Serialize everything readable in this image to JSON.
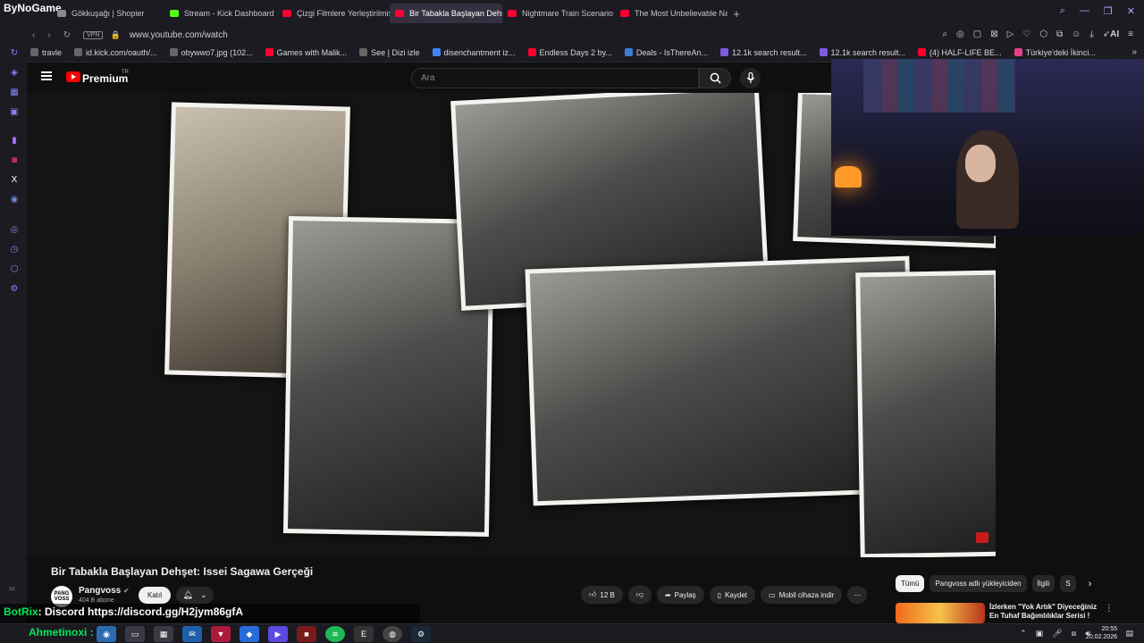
{
  "browser": {
    "brand": "ByNoGame",
    "tabs": [
      {
        "label": "Gökkuşağı | Shopier",
        "color": "#8a8a8a"
      },
      {
        "label": "Stream - Kick Dashboard",
        "color": "#53fc18"
      },
      {
        "label": "Çizgi Filmlere Yerleştirilmiş",
        "color": "#ff0033"
      },
      {
        "label": "Bir Tabakla Başlayan Dehşet",
        "color": "#ff0033"
      },
      {
        "label": "Nightmare Train Scenario",
        "color": "#ff0033"
      },
      {
        "label": "The Most Unbelievable Na",
        "color": "#ff0033"
      }
    ],
    "new_tab": "+",
    "address": {
      "vpn": "VPN",
      "url": "www.youtube.com/watch",
      "ai_label": "AI"
    },
    "bookmarks": [
      "travle",
      "id.kick.com/oauth/...",
      "obywwo7.jpg (102...",
      "Games with Malik...",
      "See | Dizi izle",
      "disenchantment iz...",
      "Endless Days 2 by...",
      "Deals - IsThereAn...",
      "12.1k search result...",
      "12.1k search result...",
      "(4) HALF-LIFE BE...",
      "Türkiye'deki İkinci..."
    ]
  },
  "youtube": {
    "logo_text": "Premium",
    "region": "TR",
    "search_placeholder": "Ara",
    "video": {
      "title": "Bir Tabakla Başlayan Dehşet: Issei Sagawa Gerçeği"
    },
    "channel": {
      "avatar_text": "PANG VOSS",
      "name": "Pangvoss",
      "subscribers": "404 B abone",
      "join": "Katıl"
    },
    "actions": {
      "likes": "12 B",
      "share": "Paylaş",
      "save": "Kaydet",
      "download": "Mobil cihaza indir"
    },
    "chips": [
      "Tümü",
      "Pangvoss adlı yükleyiciden",
      "İlgili",
      "S"
    ],
    "recommendation": {
      "title": "İzlerken \"Yok Artık\" Diyeceğiniz En Tuhaf Bağımlılıklar Serisi !"
    }
  },
  "overlay": {
    "sx": "sx",
    "chat_user": "BotRix",
    "chat_message": ": Discord https://discord.gg/H2jym86gfA"
  },
  "taskbar": {
    "user": "Ahmetinoxi :",
    "time": "20:55",
    "date": "20.02.2026"
  }
}
